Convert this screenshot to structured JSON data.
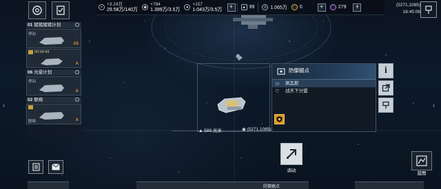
{
  "top_bar": {
    "resources": [
      {
        "icon": "currency-icon",
        "symbol": "≈",
        "delta": "+3.24万",
        "amount": "29.58万/140万"
      },
      {
        "icon": "crystal-icon",
        "symbol": "◆",
        "delta": "+784",
        "amount": "1.399万/3.5万"
      },
      {
        "icon": "deuterium-icon",
        "symbol": "●",
        "delta": "+157",
        "amount": "1.043万/3.5万"
      }
    ],
    "energy": {
      "icon": "fuel-icon",
      "value": "99"
    },
    "credits": {
      "icon": "credits-icon",
      "value": "1.065万"
    },
    "alloy": {
      "icon": "hexagon-icon",
      "value": "0"
    },
    "premium": {
      "icon": "premium-hex-icon",
      "value": "279"
    },
    "plus_label": "+"
  },
  "location": {
    "coords": "(5271,1085)",
    "time": "16:45:08"
  },
  "fleet_list": {
    "groups": [
      {
        "num": "01",
        "name": "猪猪猪猪计划",
        "cards": [
          {
            "status": "停泊",
            "grade": "A5",
            "timer": ""
          },
          {
            "status": "",
            "grade": "A",
            "timer": "00:04:43"
          }
        ]
      },
      {
        "num": "06",
        "name": "光晕计划",
        "cards": [
          {
            "status": "停泊",
            "grade": "A",
            "timer": ""
          }
        ]
      },
      {
        "num": "02",
        "name": "联络",
        "cards": [
          {
            "status": "联络",
            "grade": "A",
            "timer": ""
          }
        ]
      }
    ]
  },
  "map": {
    "distance": "589 光米",
    "target_coords": "(5271,1085)"
  },
  "info_panel": {
    "title": "防御据点",
    "rows": [
      {
        "icon": "location-icon",
        "text": "佩瓦斯"
      },
      {
        "icon": "shield-icon",
        "text": "战天下分盟"
      }
    ]
  },
  "actions": {
    "dispatch_label": "调动",
    "blueprint_label": "蓝图",
    "bottom_tab": "防御据点"
  },
  "colors": {
    "accent_orange": "#d99a26",
    "grade_orange": "#e08c30",
    "panel_highlight": "#46709f"
  }
}
